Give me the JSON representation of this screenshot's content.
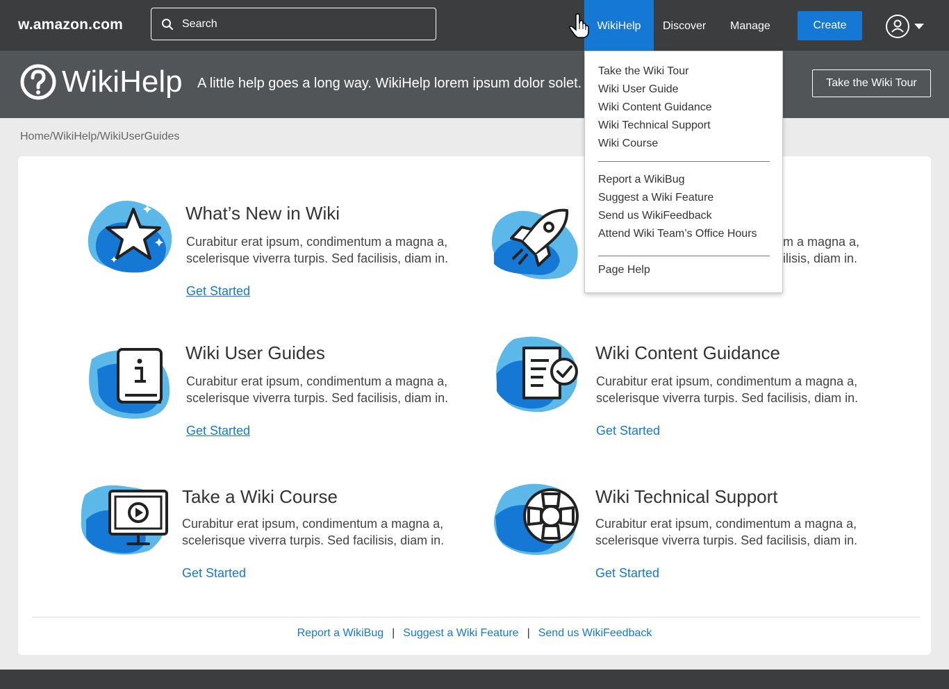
{
  "topbar": {
    "logo": "w.amazon.com",
    "search_placeholder": "Search",
    "nav": [
      "WikiHelp",
      "Discover",
      "Manage"
    ],
    "create_label": "Create"
  },
  "banner": {
    "title": "WikiHelp",
    "tagline": "A little help goes a long way. WikiHelp lorem ipsum dolor solet.",
    "tour_label": "Take the Wiki Tour"
  },
  "breadcrumb": "Home/WikiHelp/WikiUserGuides",
  "tiles": [
    {
      "title": "What’s New in Wiki",
      "desc": "Curabitur erat ipsum, condimentum a magna a, scelerisque viverra turpis. Sed facilisis, diam in.",
      "link": "Get Started",
      "icon": "star-icon"
    },
    {
      "title": "",
      "desc": "Curabitur erat ipsum, condimentum a magna a, scelerisque viverra turpis. Sed facilisis, diam in.",
      "link": "",
      "icon": "rocket-icon"
    },
    {
      "title": "Wiki User Guides",
      "desc": "Curabitur erat ipsum, condimentum a magna a, scelerisque viverra turpis. Sed facilisis, diam in.",
      "link": "Get Started",
      "icon": "info-book-icon"
    },
    {
      "title": "Wiki Content Guidance",
      "desc": "Curabitur erat ipsum, condimentum a magna a, scelerisque viverra turpis. Sed facilisis, diam in.",
      "link": "Get Started",
      "icon": "document-check-icon"
    },
    {
      "title": "Take a Wiki Course",
      "desc": "Curabitur erat ipsum, condimentum a magna a, scelerisque viverra turpis. Sed facilisis, diam in.",
      "link": "Get Started",
      "icon": "video-monitor-icon"
    },
    {
      "title": "Wiki Technical Support",
      "desc": "Curabitur erat ipsum, condimentum a magna a, scelerisque viverra turpis. Sed facilisis, diam in.",
      "link": "Get Started",
      "icon": "lifebuoy-icon"
    }
  ],
  "partial_tile_text": {
    "line1": "m a magna a,",
    "line2": "ilisis, diam in."
  },
  "footer_links": [
    "Report a WikiBug",
    "Suggest a Wiki Feature",
    "Send us WikiFeedback"
  ],
  "dropdown": {
    "group1": [
      "Take the Wiki Tour",
      "Wiki User Guide",
      "Wiki Content Guidance",
      "Wiki Technical Support",
      "Wiki Course"
    ],
    "group2": [
      "Report a WikiBug",
      "Suggest a Wiki Feature",
      "Send us WikiFeedback",
      "Attend Wiki Team’s Office Hours"
    ],
    "group3": [
      "Page Help"
    ]
  },
  "colors": {
    "topbar": "#3b3d3f",
    "banner": "#525558",
    "accent_blue": "#1478d4",
    "light_blue": "#5bb8e8",
    "page_bg": "#ebebeb"
  }
}
